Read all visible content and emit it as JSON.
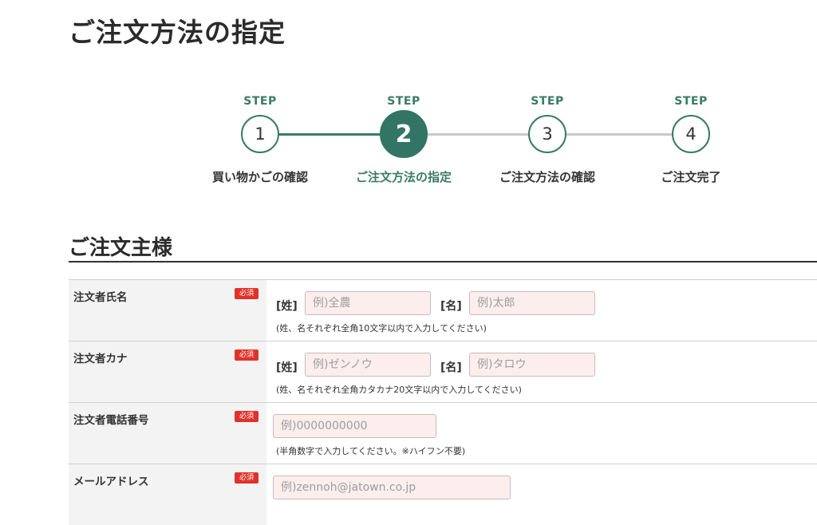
{
  "page_title": "ご注文方法の指定",
  "stepper": {
    "steps": [
      {
        "top": "STEP",
        "num": "1",
        "name": "買い物かごの確認"
      },
      {
        "top": "STEP",
        "num": "2",
        "name": "ご注文方法の指定"
      },
      {
        "top": "STEP",
        "num": "3",
        "name": "ご注文方法の確認"
      },
      {
        "top": "STEP",
        "num": "4",
        "name": "ご注文完了"
      }
    ],
    "active_index": 1,
    "accent_color": "#3a7a66"
  },
  "section_title": "ご注文主様",
  "form": {
    "required_label": "必須",
    "rows": [
      {
        "label": "注文者氏名",
        "last_bracket": "[姓]",
        "first_bracket": "[名]",
        "last_placeholder": "例)全農",
        "first_placeholder": "例)太郎",
        "note": "(姓、名それぞれ全角10文字以内で入力してください)"
      },
      {
        "label": "注文者カナ",
        "last_bracket": "[姓]",
        "first_bracket": "[名]",
        "last_placeholder": "例)ゼンノウ",
        "first_placeholder": "例)タロウ",
        "note": "(姓、名それぞれ全角カタカナ20文字以内で入力してください)"
      },
      {
        "label": "注文者電話番号",
        "placeholder": "例)0000000000",
        "note": "(半角数字で入力してください。※ハイフン不要)"
      },
      {
        "label": "メールアドレス",
        "placeholder": "例)zennoh@jatown.co.jp"
      }
    ]
  }
}
